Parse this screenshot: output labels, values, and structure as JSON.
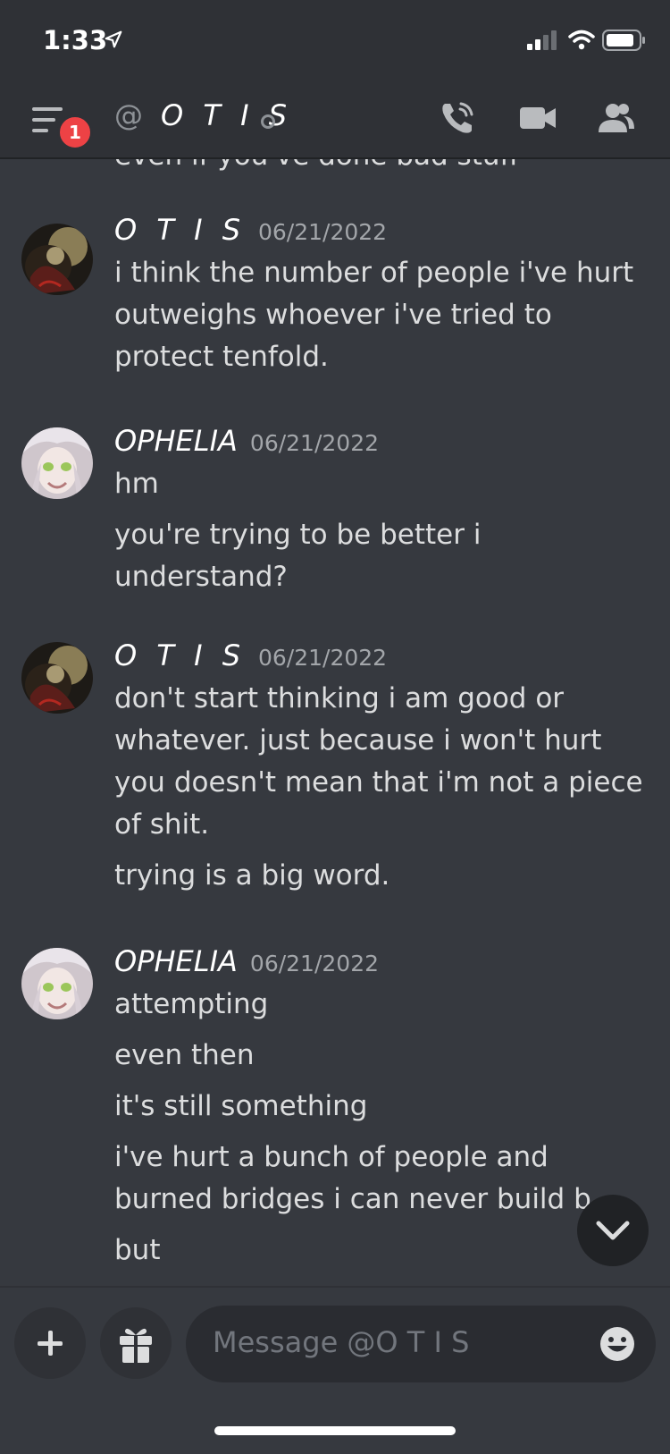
{
  "status_bar": {
    "time": "1:33"
  },
  "header": {
    "notification_count": "1",
    "at_symbol": "@",
    "channel_name": "O T I S"
  },
  "messages": {
    "cut_text": "even if you've done bad stuff",
    "groups": [
      {
        "author": "O T I S",
        "timestamp": "06/21/2022",
        "lines": [
          "i think the number of people i've hurt outweighs whoever i've tried to protect tenfold."
        ]
      },
      {
        "author": "OPHELIA",
        "timestamp": "06/21/2022",
        "lines": [
          "hm",
          "you're trying to be better i understand?"
        ]
      },
      {
        "author": "O T I S",
        "timestamp": "06/21/2022",
        "lines": [
          "don't start thinking i am good or whatever. just because i won't hurt you doesn't mean that i'm not a piece of shit.",
          "trying is a big word."
        ]
      },
      {
        "author": "OPHELIA",
        "timestamp": "06/21/2022",
        "lines": [
          "attempting",
          "even then",
          "it's still something",
          "i've hurt a bunch of people and burned bridges i can never build b",
          "but"
        ]
      }
    ]
  },
  "composer": {
    "placeholder": "Message @O T I S"
  },
  "icons": {
    "menu": "hamburger-icon",
    "call": "phone-icon",
    "video": "video-camera-icon",
    "members": "members-icon",
    "add": "plus-icon",
    "gift": "gift-icon",
    "emoji": "emoji-icon",
    "scroll": "chevron-down-icon"
  },
  "colors": {
    "background": "#36393f",
    "header": "#2f3136",
    "badge": "#ed4245",
    "text": "#dcddde",
    "muted": "#a3a6aa"
  }
}
